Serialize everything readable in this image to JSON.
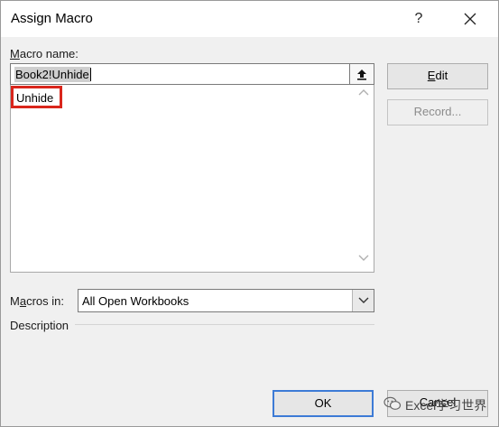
{
  "window": {
    "title": "Assign Macro",
    "help_symbol": "?"
  },
  "macro_name": {
    "label_underlined": "M",
    "label_rest": "acro name:",
    "value": "Book2!Unhide"
  },
  "macro_list": {
    "items": [
      "Unhide"
    ],
    "highlight_color": "#d9261c"
  },
  "buttons": {
    "edit_underlined": "E",
    "edit_rest": "dit",
    "record": "Record...",
    "ok": "OK",
    "cancel": "Cancel"
  },
  "macros_in": {
    "label_pre": "M",
    "label_underlined": "a",
    "label_rest": "cros in:",
    "selected": "All Open Workbooks"
  },
  "description": {
    "label": "Description"
  },
  "watermark": {
    "text": "Excel学习世界"
  },
  "icons": [
    "close-icon",
    "upload-arrow-icon",
    "scroll-up-icon",
    "scroll-down-icon",
    "dropdown-arrow-icon",
    "wechat-icon"
  ]
}
